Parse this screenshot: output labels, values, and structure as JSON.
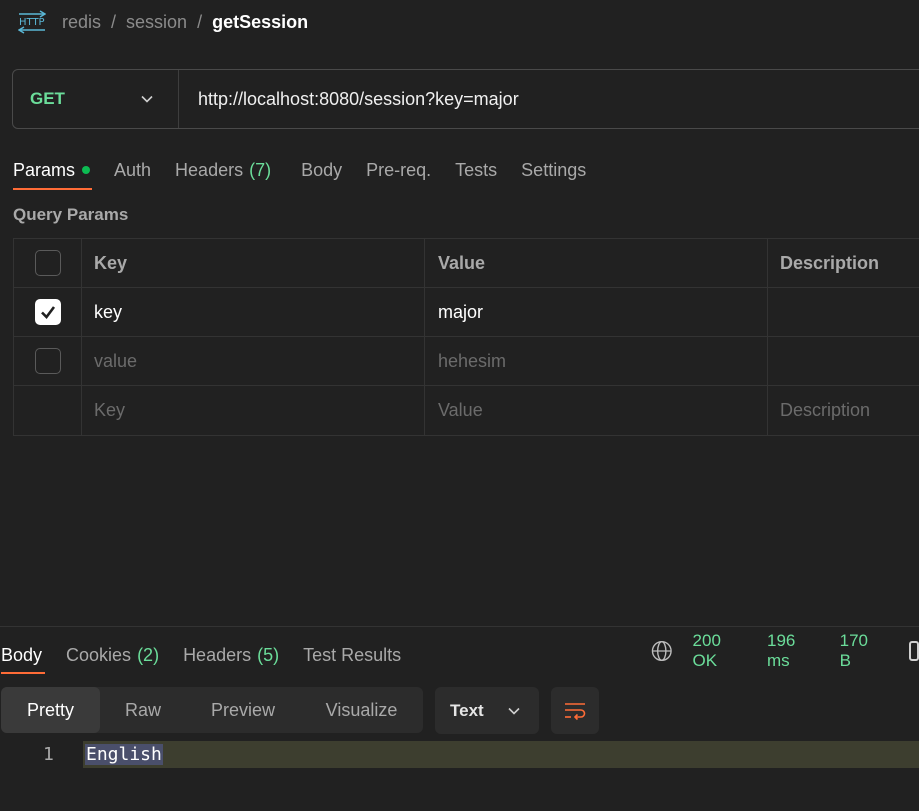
{
  "breadcrumb": {
    "icon": "http-icon",
    "parts": [
      "redis",
      "session"
    ],
    "current": "getSession"
  },
  "request": {
    "method": "GET",
    "url": "http://localhost:8080/session?key=major"
  },
  "request_tabs": [
    {
      "label": "Params",
      "active": true,
      "dot": true
    },
    {
      "label": "Auth"
    },
    {
      "label": "Headers",
      "count": "(7)"
    },
    {
      "label": "Body"
    },
    {
      "label": "Pre-req."
    },
    {
      "label": "Tests"
    },
    {
      "label": "Settings"
    }
  ],
  "query_params": {
    "title": "Query Params",
    "headers": [
      "Key",
      "Value",
      "Description"
    ],
    "rows": [
      {
        "checked": true,
        "key": "key",
        "value": "major",
        "description": ""
      },
      {
        "checked": false,
        "key": "value",
        "value": "hehesim",
        "description": ""
      }
    ],
    "placeholder": {
      "key": "Key",
      "value": "Value",
      "description": "Description"
    }
  },
  "response_tabs": [
    {
      "label": "Body",
      "active": true
    },
    {
      "label": "Cookies",
      "count": "(2)"
    },
    {
      "label": "Headers",
      "count": "(5)"
    },
    {
      "label": "Test Results"
    }
  ],
  "status": {
    "code": "200 OK",
    "time": "196 ms",
    "size": "170 B"
  },
  "view_modes": [
    "Pretty",
    "Raw",
    "Preview",
    "Visualize"
  ],
  "selected_view": "Pretty",
  "format": "Text",
  "body_lines": [
    {
      "n": "1",
      "text": "English"
    }
  ],
  "colors": {
    "accent": "#ff6c37",
    "method": "#6bdd9a",
    "status": "#6bdd9a",
    "bg": "#212121"
  }
}
